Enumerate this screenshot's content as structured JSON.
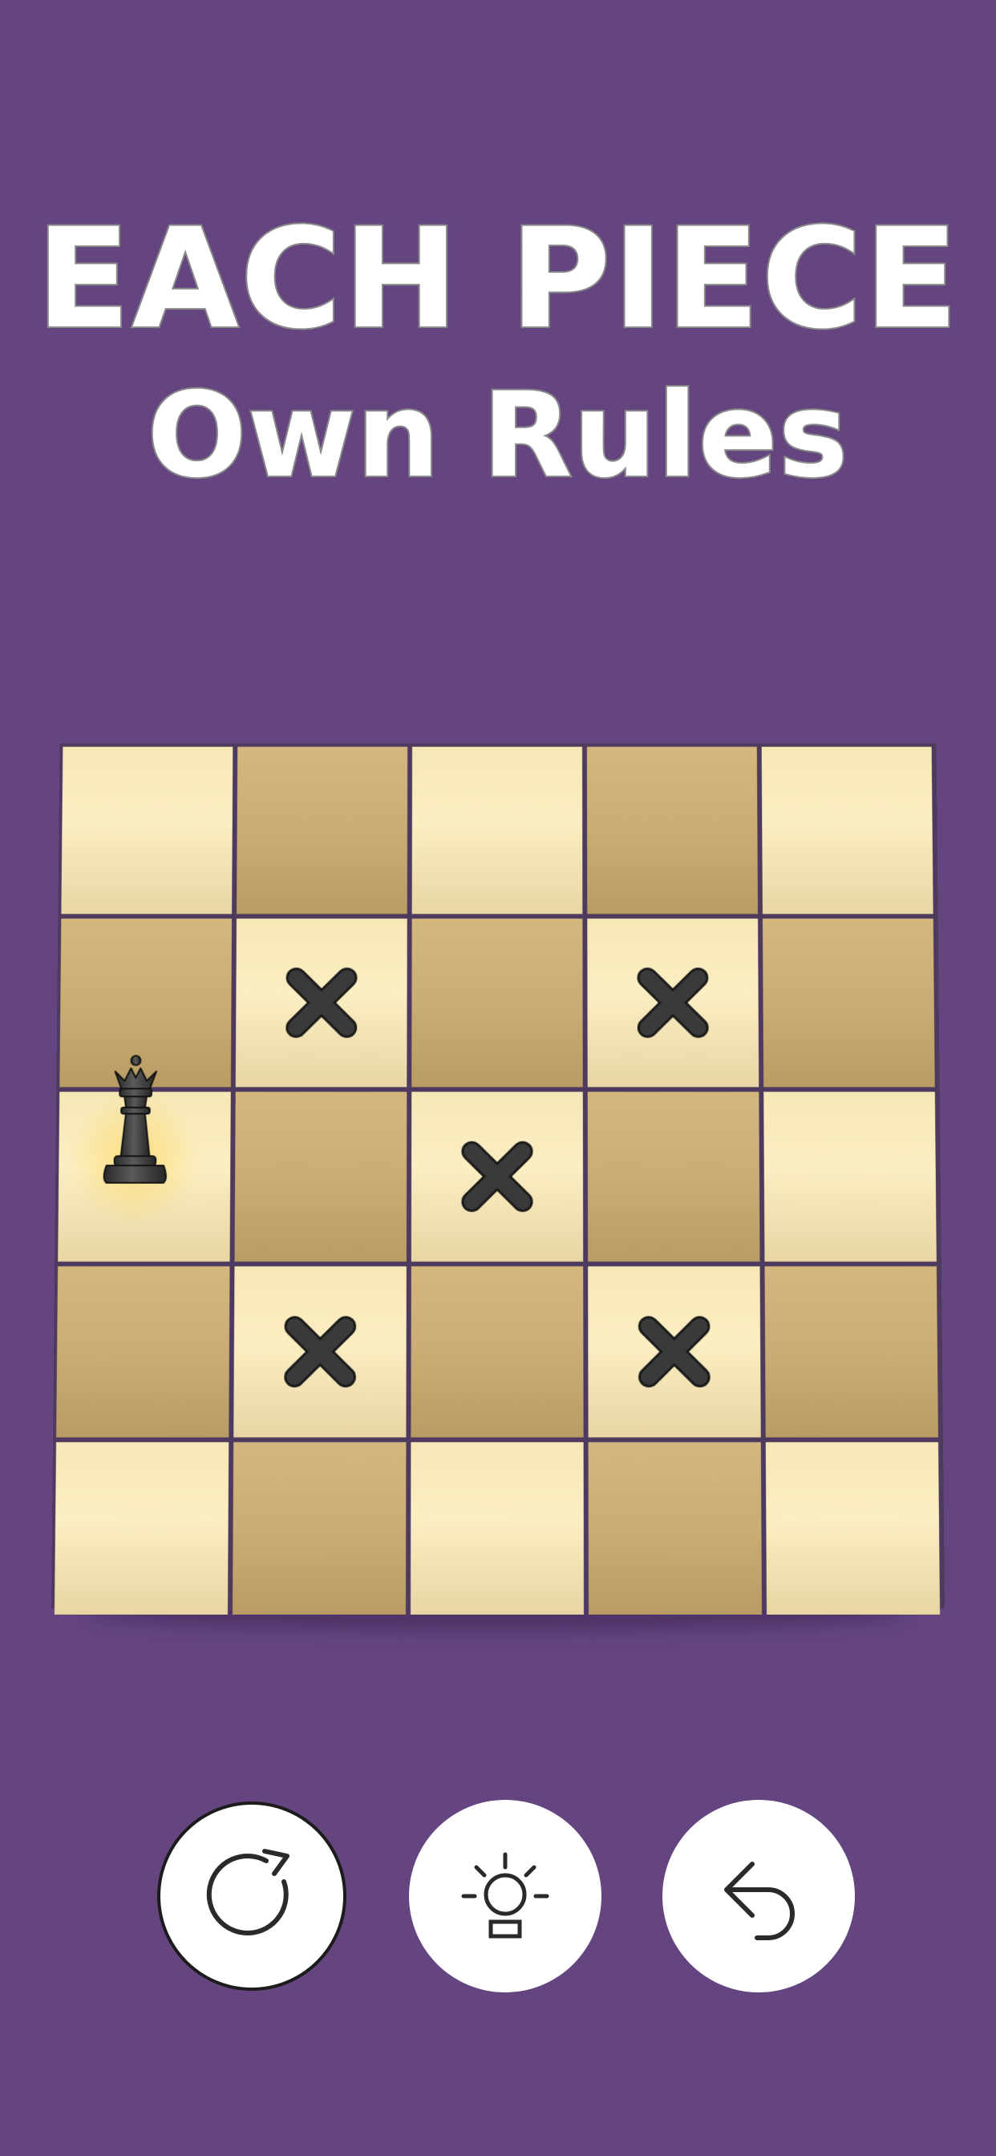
{
  "headline": {
    "line1": "EACH PIECE",
    "line2": "Own Rules"
  },
  "board": {
    "rows": 5,
    "cols": 5,
    "colors": {
      "light": "#f8ebbd",
      "dark": "#c9ad74",
      "grout": "#4e3a5f",
      "mark": "#3a3a3a",
      "piece": "#3b3b3b",
      "highlight": "#ffd650"
    },
    "piece": {
      "type": "queen",
      "icon": "queen-icon",
      "color": "black",
      "row": 3,
      "col": 1,
      "highlighted": true
    },
    "marked_squares": [
      {
        "row": 2,
        "col": 2
      },
      {
        "row": 2,
        "col": 4
      },
      {
        "row": 3,
        "col": 3
      },
      {
        "row": 4,
        "col": 2
      },
      {
        "row": 4,
        "col": 4
      }
    ],
    "mark_icon": "x-mark-icon"
  },
  "controls": {
    "background": "#ffffff",
    "restart": {
      "icon": "restart-icon"
    },
    "hint": {
      "icon": "lightbulb-icon"
    },
    "undo": {
      "icon": "undo-icon"
    }
  }
}
